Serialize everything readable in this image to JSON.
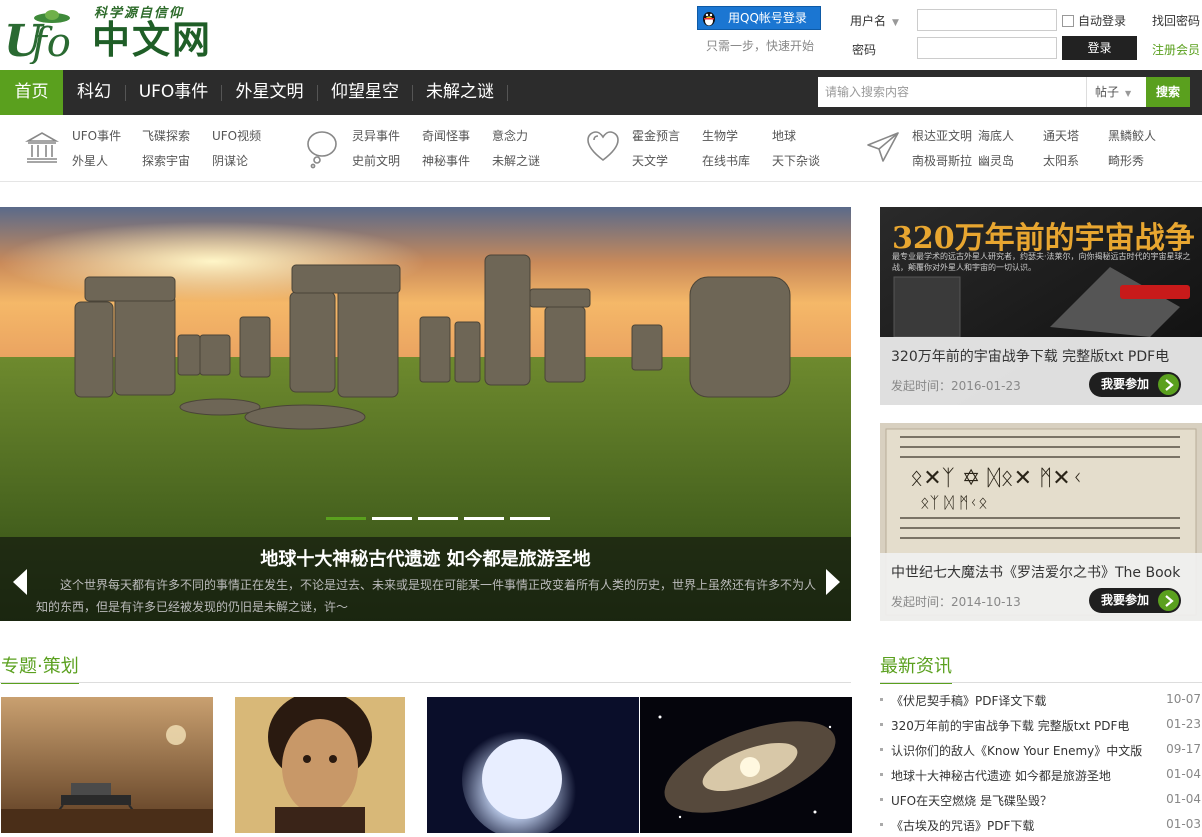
{
  "header": {
    "logo_slogan": "科学源自信仰",
    "logo_name": "中文网",
    "qq_login": "用QQ帐号登录",
    "qq_hint": "只需一步，快速开始",
    "username_label": "用户名",
    "password_label": "密码",
    "auto_login": "自动登录",
    "forgot": "找回密码",
    "login": "登录",
    "register": "注册会员"
  },
  "nav": {
    "items": [
      "首页",
      "科幻",
      "UFO事件",
      "外星文明",
      "仰望星空",
      "未解之谜"
    ],
    "search_placeholder": "请输入搜索内容",
    "search_type": "帖子",
    "search_button": "搜索"
  },
  "categories": {
    "g1": [
      "UFO事件",
      "飞碟探索",
      "UFO视频",
      "外星人",
      "探索宇宙",
      "阴谋论"
    ],
    "g2": [
      "灵异事件",
      "奇闻怪事",
      "意念力",
      "史前文明",
      "神秘事件",
      "未解之谜"
    ],
    "g3": [
      "霍金预言",
      "生物学",
      "地球",
      "天文学",
      "在线书库",
      "天下杂谈"
    ],
    "g4": [
      "根达亚文明",
      "海底人",
      "通天塔",
      "黑鳞鲛人",
      "南极哥斯拉",
      "幽灵岛",
      "太阳系",
      "畸形秀"
    ]
  },
  "hero": {
    "title": "地球十大神秘古代遗迹 如今都是旅游圣地",
    "summary": "这个世界每天都有许多不同的事情正在发生，不论是过去、未来或是现在可能某一件事情正改变着所有人类的历史，世界上虽然还有许多不为人知的东西，但是有许多已经被发现的仍旧是未解之谜，许～"
  },
  "promos": [
    {
      "banner_title": "320万年前的宇宙战争",
      "banner_desc": "最专业最学术的远古外星人研究者，约瑟夫·法莱尔，向你揭秘远古时代的宇宙星球之战，颠覆你对外星人和宇宙的一切认识。",
      "title": "320万年前的宇宙战争下载 完整版txt PDF电",
      "date": "发起时间：2016-01-23",
      "join": "我要参加"
    },
    {
      "title": "中世纪七大魔法书《罗洁爱尔之书》The Book",
      "date": "发起时间：2014-10-13",
      "join": "我要参加"
    }
  ],
  "sections": {
    "topics": "专题·策划",
    "news": "最新资讯"
  },
  "news": [
    {
      "title": "《伏尼契手稿》PDF译文下载",
      "date": "10-07"
    },
    {
      "title": "320万年前的宇宙战争下载 完整版txt PDF电",
      "date": "01-23"
    },
    {
      "title": "认识你们的敌人《Know Your Enemy》中文版",
      "date": "09-17"
    },
    {
      "title": "地球十大神秘古代遗迹 如今都是旅游圣地",
      "date": "01-04"
    },
    {
      "title": "UFO在天空燃烧 是飞碟坠毁？",
      "date": "01-04"
    },
    {
      "title": "《古埃及的咒语》PDF下载",
      "date": "01-03"
    }
  ]
}
